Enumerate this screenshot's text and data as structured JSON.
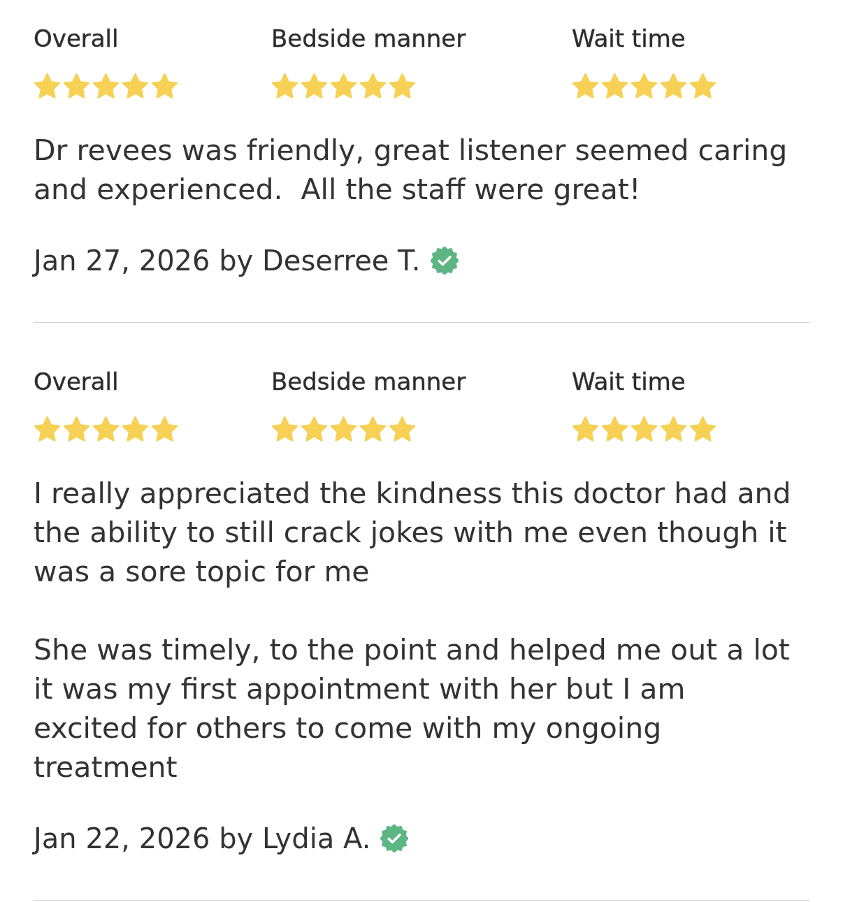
{
  "reviews": [
    {
      "ratings": [
        {
          "label": "Overall",
          "stars": 5
        },
        {
          "label": "Bedside manner",
          "stars": 5
        },
        {
          "label": "Wait time",
          "stars": 5
        }
      ],
      "paragraphs": [
        "Dr revees was friendly, great listener seemed caring and experienced.  All the staff were great!"
      ],
      "byline": "Jan 27, 2026 by Deserree T.",
      "verified": true
    },
    {
      "ratings": [
        {
          "label": "Overall",
          "stars": 5
        },
        {
          "label": "Bedside manner",
          "stars": 5
        },
        {
          "label": "Wait time",
          "stars": 5
        }
      ],
      "paragraphs": [
        "I really appreciated the kindness this doctor had and the ability to still crack jokes with me even though it was a sore topic for me",
        "She was timely, to the point and helped me out a lot it was my first appointment with her but I am excited for others to come with my ongoing treatment"
      ],
      "byline": "Jan 22, 2026 by Lydia A.",
      "verified": true
    }
  ]
}
